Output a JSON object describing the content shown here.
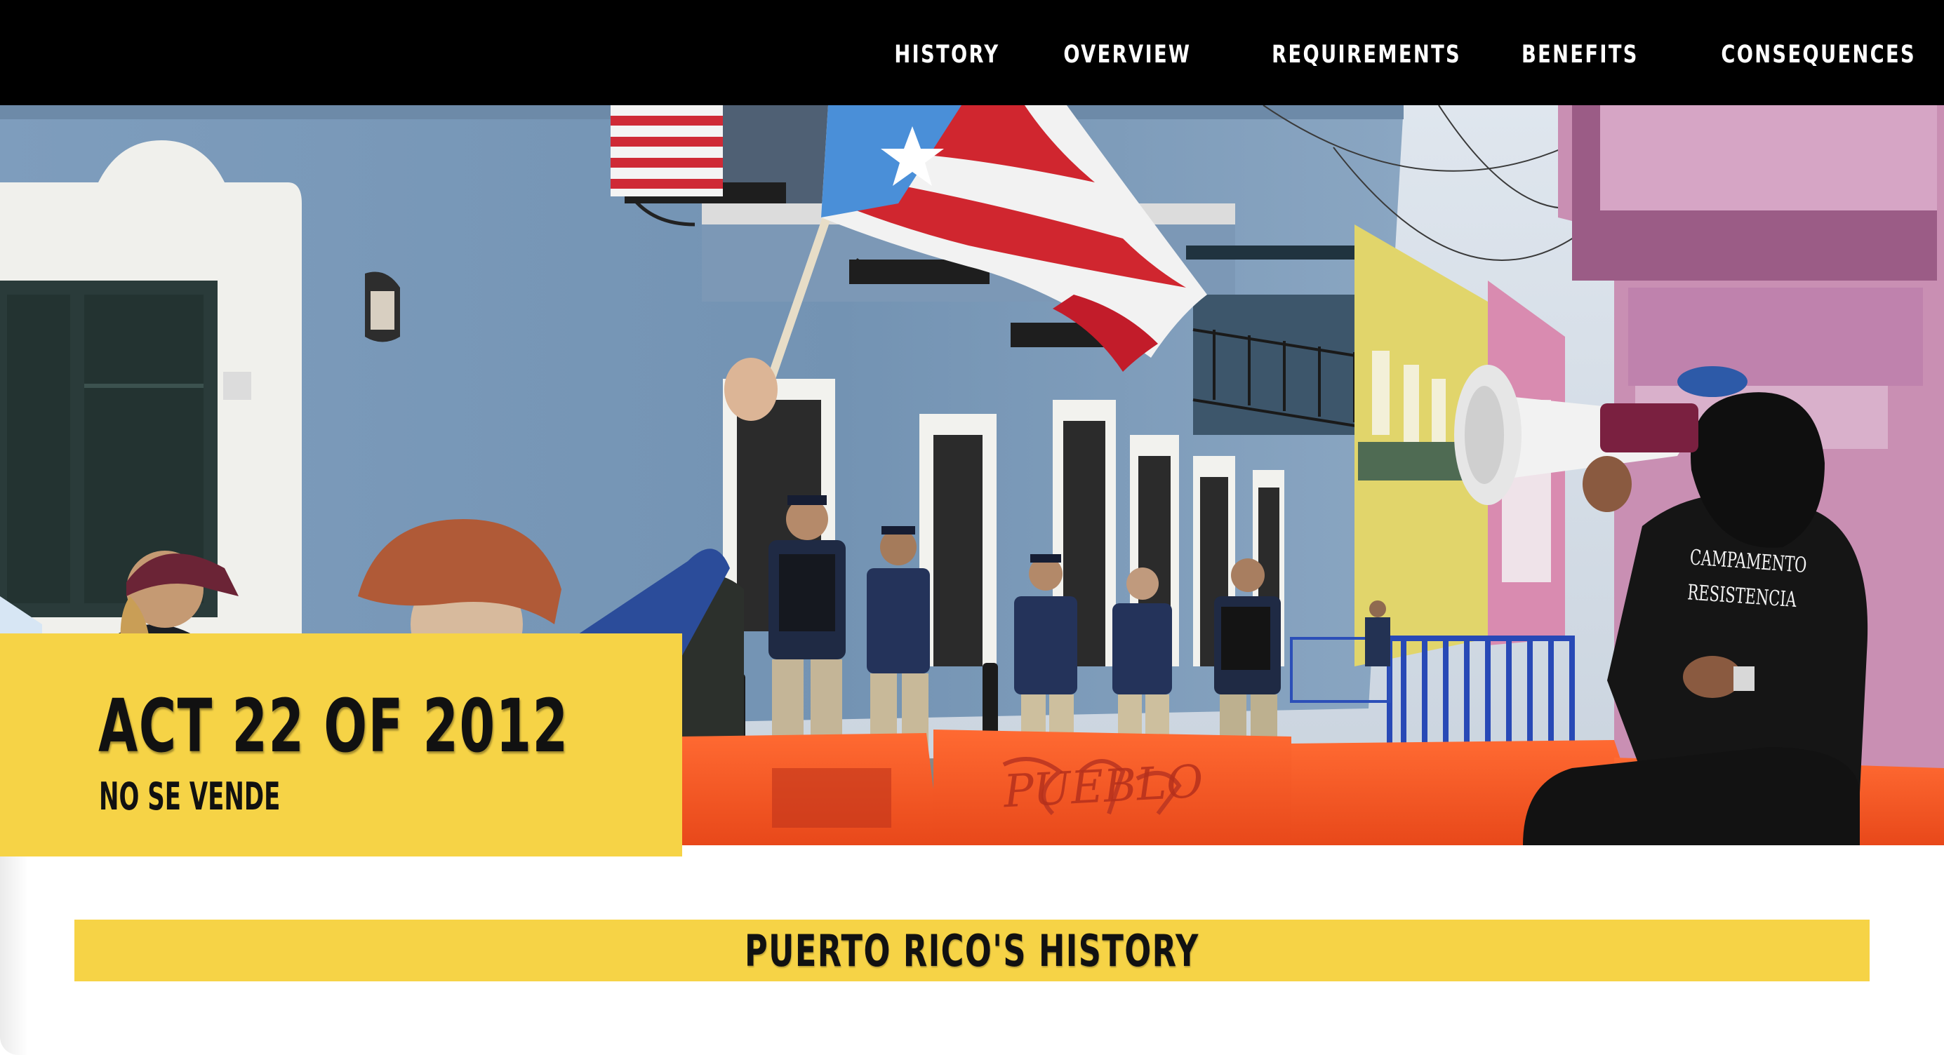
{
  "nav": {
    "items": [
      {
        "label": "HISTORY"
      },
      {
        "label": "OVERVIEW"
      },
      {
        "label": "REQUIREMENTS"
      },
      {
        "label": "BENEFITS"
      },
      {
        "label": "CONSEQUENCES"
      }
    ]
  },
  "hero": {
    "title": "ACT 22 OF 2012",
    "subtitle": "NO SE VENDE",
    "shirt_text_line1": "CAMPAMENTO",
    "shirt_text_line2": "RESISTENCIA",
    "graffiti": "PUEBLO"
  },
  "section": {
    "title": "PUERTO RICO'S HISTORY"
  },
  "colors": {
    "nav_background": "#000000",
    "accent_yellow": "#f6d346",
    "text_dark": "#111111",
    "page_background": "#ffffff"
  }
}
